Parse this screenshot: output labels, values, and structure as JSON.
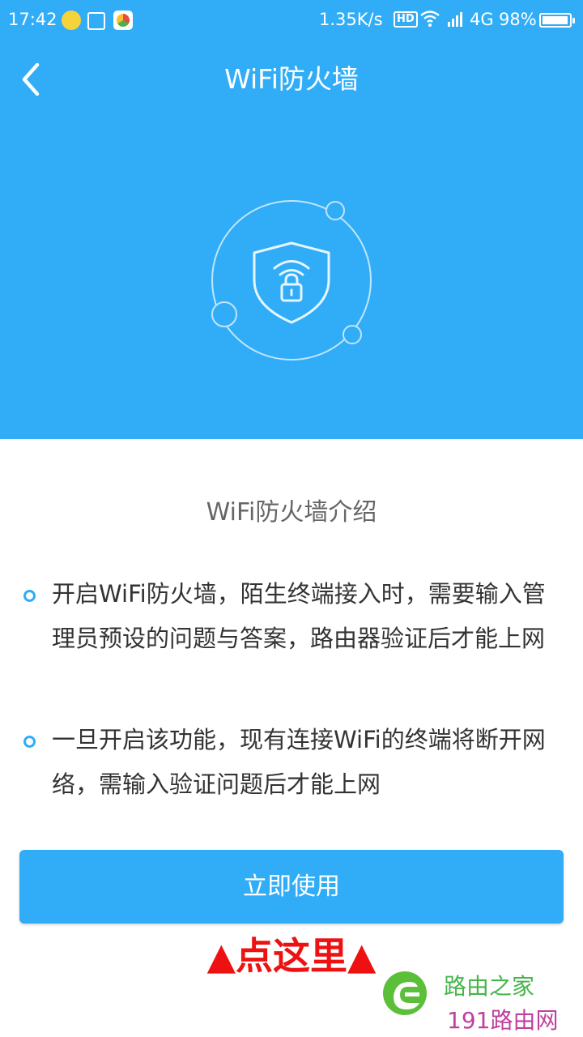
{
  "status_bar": {
    "time": "17:42",
    "speed": "1.35K/s",
    "hd": "HD",
    "network": "4G",
    "battery": "98%",
    "icons": [
      "wechat-icon",
      "scan-icon",
      "app-icon",
      "wifi-icon",
      "signal-icon",
      "battery-icon"
    ]
  },
  "header": {
    "title": "WiFi防火墙",
    "back_icon": "chevron-left-icon"
  },
  "hero": {
    "illustration": "shield-lock-wifi-icon",
    "bg_color": "#31adf7"
  },
  "intro": {
    "title": "WiFi防火墙介绍",
    "bullets": [
      "开启WiFi防火墙，陌生终端接入时，需要输入管理员预设的问题与答案，路由器验证后才能上网",
      "一旦开启该功能，现有连接WiFi的终端将断开网络，需输入验证问题后才能上网"
    ]
  },
  "action": {
    "use_label": "立即使用"
  },
  "annotation": {
    "text": "▲点这里▲",
    "color": "#ee1111"
  },
  "watermark": {
    "brand": "路由之家",
    "site": "191路由网"
  }
}
